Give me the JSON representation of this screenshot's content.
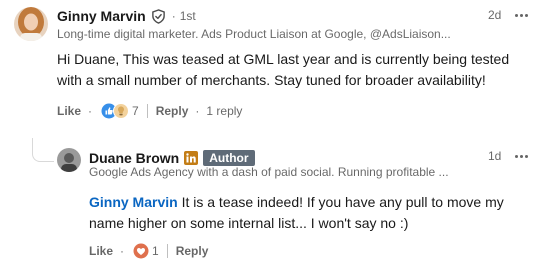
{
  "comments": [
    {
      "author": "Ginny Marvin",
      "degree": "1st",
      "separator": "·",
      "headline": "Long-time digital marketer. Ads Product Liaison at Google, @AdsLiaison...",
      "time": "2d",
      "body": "Hi Duane, This was teased at GML last year and is currently being tested with a small number of merchants. Stay tuned for broader availability!",
      "like_label": "Like",
      "reaction_count": "7",
      "reply_label": "Reply",
      "replies_text": "1 reply"
    },
    {
      "author": "Duane Brown",
      "author_tag": "Author",
      "headline": "Google Ads Agency with a dash of paid social. Running profitable ...",
      "time": "1d",
      "mention": "Ginny Marvin",
      "body": "It is a tease indeed! If you have any pull to move my name higher on some internal list... I won't say no :)",
      "like_label": "Like",
      "reaction_count": "1",
      "reply_label": "Reply"
    }
  ],
  "colors": {
    "link_blue": "#0a66c2",
    "author_tag_bg": "#5f6b78",
    "like_blue": "#378fe9",
    "support_tan": "#d9a95c",
    "love_red": "#df704d"
  },
  "icons": [
    "verified-shield-icon",
    "linkedin-badge-icon",
    "like-reaction-icon",
    "support-reaction-icon",
    "love-reaction-icon",
    "more-options-icon"
  ]
}
